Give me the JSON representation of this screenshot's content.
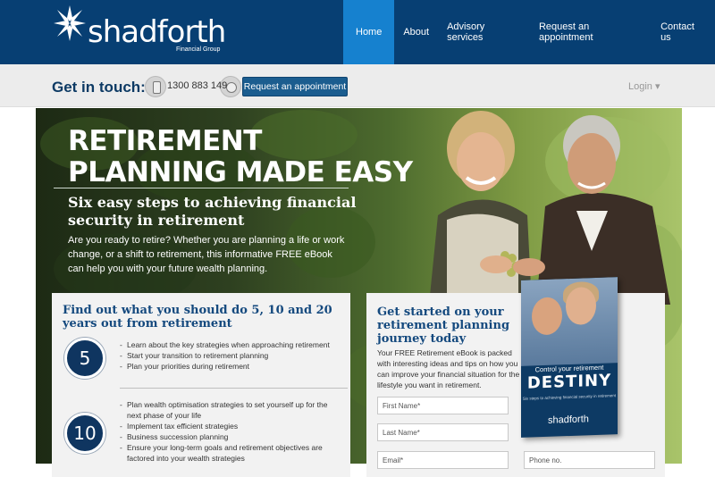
{
  "brand": {
    "name": "shadforth",
    "sub": "Financial Group"
  },
  "nav": {
    "items": [
      {
        "label": "Home"
      },
      {
        "label": "About"
      },
      {
        "label": "Advisory services"
      },
      {
        "label": "Request an appointment"
      },
      {
        "label": "Contact us"
      }
    ],
    "active": "Home"
  },
  "contact": {
    "heading": "Get in touch:",
    "phone": "1300 883 149",
    "button": "Request an appointment",
    "login": "Login ▾"
  },
  "hero": {
    "title_line1": "RETIREMENT",
    "title_line2": "PLANNING MADE EASY",
    "subtitle": "Six easy steps to achieving financial security in retirement",
    "description": "Are you ready to retire? Whether you are planning a life or work change, or a shift to retirement, this informative FREE eBook can help you with your future wealth planning."
  },
  "left_panel": {
    "heading": "Find out what you should do 5, 10 and 20 years out from retirement",
    "groups": [
      {
        "number": "5",
        "bullets": [
          "Learn about the key strategies when approaching retirement",
          "Start your transition to retirement planning",
          "Plan your priorities during retirement"
        ]
      },
      {
        "number": "10",
        "bullets": [
          "Plan wealth optimisation strategies to set yourself up for the next phase of your life",
          "Implement tax efficient strategies",
          "Business succession planning",
          "Ensure your long-term goals and retirement objectives are factored into your wealth strategies"
        ]
      }
    ]
  },
  "right_panel": {
    "heading": "Get started on your retirement planning journey today",
    "description": "Your FREE Retirement eBook is packed with interesting ideas and tips on how you can improve your financial situation for the lifestyle you want in retirement.",
    "fields": {
      "first_name": "First Name*",
      "last_name": "Last Name*",
      "email": "Email*",
      "phone": "Phone no."
    }
  },
  "ebook": {
    "line1": "Control your retirement",
    "line2": "DESTINY",
    "line3": "Six steps to achieving financial security in retirement",
    "logo": "shadforth"
  },
  "colors": {
    "navy": "#073f73",
    "nav_active": "#1681cf",
    "heading_blue": "#14497e",
    "button_blue": "#1b5d8f"
  }
}
